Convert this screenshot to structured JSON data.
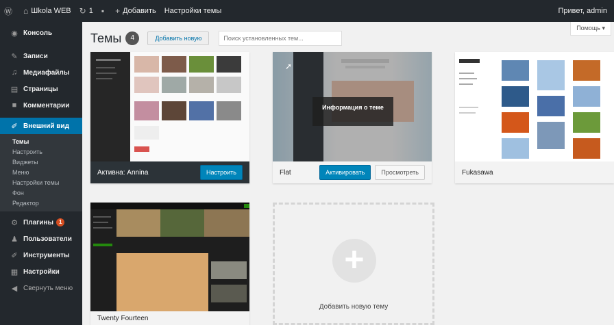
{
  "adminbar": {
    "wp_logo": "wordpress-icon",
    "site_name": "Шkola WEB",
    "updates_count": "1",
    "comments_count": "",
    "add_label": "Добавить",
    "customize_label": "Настройки темы",
    "greeting": "Привет, admin"
  },
  "sidebar": {
    "items": [
      {
        "label": "Консоль",
        "icon": "dashboard-icon"
      },
      {
        "label": "Записи",
        "icon": "pin-icon"
      },
      {
        "label": "Медиафайлы",
        "icon": "media-icon"
      },
      {
        "label": "Страницы",
        "icon": "page-icon"
      },
      {
        "label": "Комментарии",
        "icon": "comment-icon"
      },
      {
        "label": "Внешний вид",
        "icon": "brush-icon"
      }
    ],
    "submenu": [
      "Темы",
      "Настроить",
      "Виджеты",
      "Меню",
      "Настройки темы",
      "Фон",
      "Редактор"
    ],
    "items2": [
      {
        "label": "Плагины",
        "icon": "plugin-icon",
        "badge": "1"
      },
      {
        "label": "Пользователи",
        "icon": "user-icon"
      },
      {
        "label": "Инструменты",
        "icon": "wrench-icon"
      },
      {
        "label": "Настройки",
        "icon": "settings-icon"
      }
    ],
    "collapse_label": "Свернуть меню"
  },
  "header": {
    "title": "Темы",
    "count": "4",
    "add_new": "Добавить новую",
    "search_placeholder": "Поиск установленных тем..."
  },
  "help_tab": "Помощь",
  "themes": [
    {
      "name": "Активна: Annina",
      "button": "Настроить"
    },
    {
      "name": "Flat",
      "info": "Информация о теме",
      "activate": "Активировать",
      "preview": "Просмотреть"
    },
    {
      "name": "Fukasawa"
    },
    {
      "name": "Twenty Fourteen"
    }
  ],
  "add_new_theme": {
    "label": "Добавить новую тему"
  },
  "colors": {
    "accent": "#0073aa",
    "sidebar": "#23282d",
    "badge": "#d54e21"
  }
}
